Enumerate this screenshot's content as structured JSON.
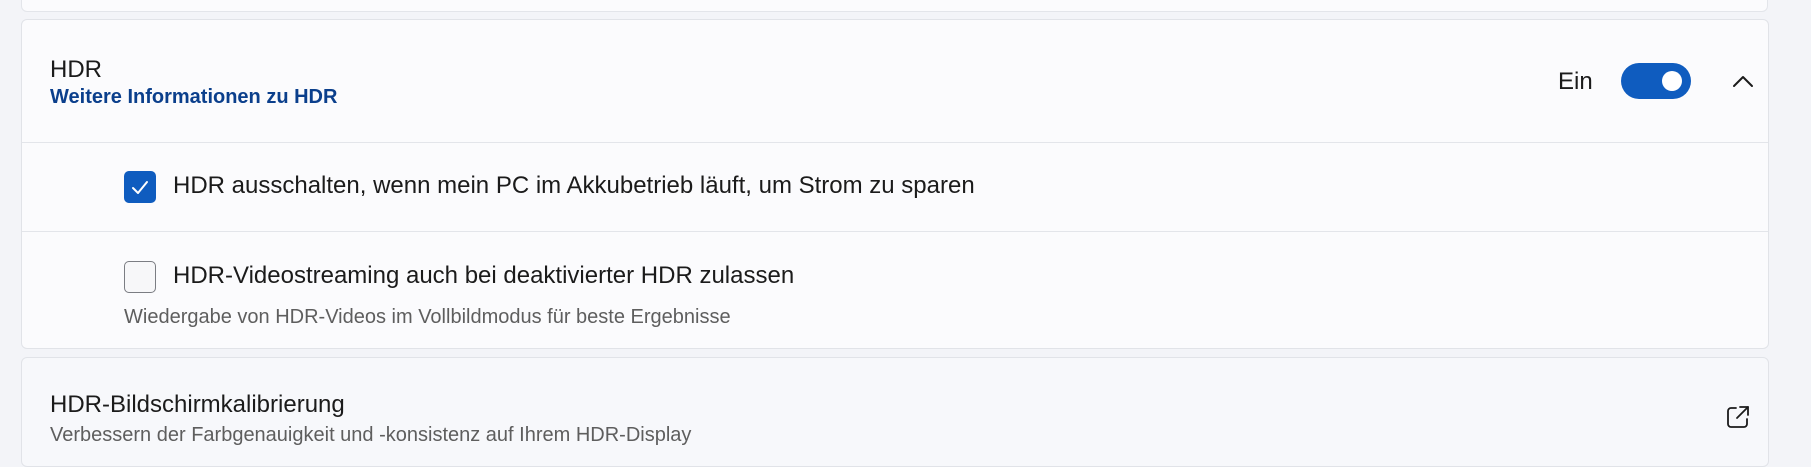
{
  "hdr": {
    "title": "HDR",
    "link": "Weitere Informationen zu HDR",
    "toggle_state": "Ein",
    "toggle_on": true,
    "chevron_icon": "chevron-up-icon"
  },
  "options": [
    {
      "label": "HDR ausschalten, wenn mein PC im Akkubetrieb läuft, um Strom zu sparen",
      "checked": true,
      "description": ""
    },
    {
      "label": "HDR-Videostreaming auch bei deaktivierter HDR zulassen",
      "checked": false,
      "description": "Wiedergabe von HDR-Videos im Vollbildmodus für beste Ergebnisse"
    }
  ],
  "calibration": {
    "title": "HDR-Bildschirmkalibrierung",
    "description": "Verbessern der Farbgenauigkeit und -konsistenz auf Ihrem HDR-Display",
    "icon": "external-link-icon"
  },
  "colors": {
    "accent": "#0f5cbf",
    "link": "#0b3f8c"
  }
}
